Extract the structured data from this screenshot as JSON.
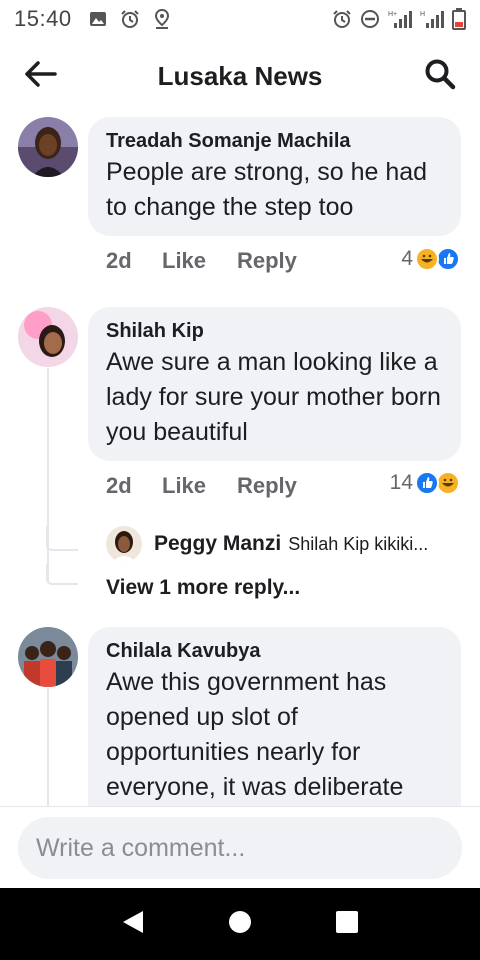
{
  "status_bar": {
    "time": "15:40",
    "left_icons": [
      "image-icon",
      "alarm-icon",
      "location-icon"
    ],
    "right_icons": [
      "alarm-icon",
      "do-not-disturb-icon",
      "signal-icon",
      "signal-icon",
      "battery-low-icon"
    ]
  },
  "header": {
    "title": "Lusaka News",
    "back_icon": "arrow-left-icon",
    "search_icon": "search-icon"
  },
  "colors": {
    "bubble": "#f0f2f5",
    "meta": "#65676b",
    "like_blue": "#1877f2",
    "haha_yellow": "#f7b125"
  },
  "comments": [
    {
      "author": "Treadah Somanje Machila",
      "text": "People are strong, so he had to change the step too",
      "time": "2d",
      "like_label": "Like",
      "reply_label": "Reply",
      "reaction_count": "4",
      "reactions": [
        "haha",
        "like"
      ]
    },
    {
      "author": "Shilah Kip",
      "text": "Awe sure a man looking like a lady for sure your mother born you beautiful",
      "time": "2d",
      "like_label": "Like",
      "reply_label": "Reply",
      "reaction_count": "14",
      "reactions": [
        "like",
        "haha"
      ],
      "reply_preview": {
        "author": "Peggy Manzi",
        "text": "Shilah Kip kikiki..."
      },
      "more_replies": "View 1 more reply..."
    },
    {
      "author": "Chilala Kavubya",
      "text": "Awe this government has opened up slot of opportunities nearly for everyone, it was deliberate"
    }
  ],
  "composer": {
    "placeholder": "Write a comment..."
  }
}
